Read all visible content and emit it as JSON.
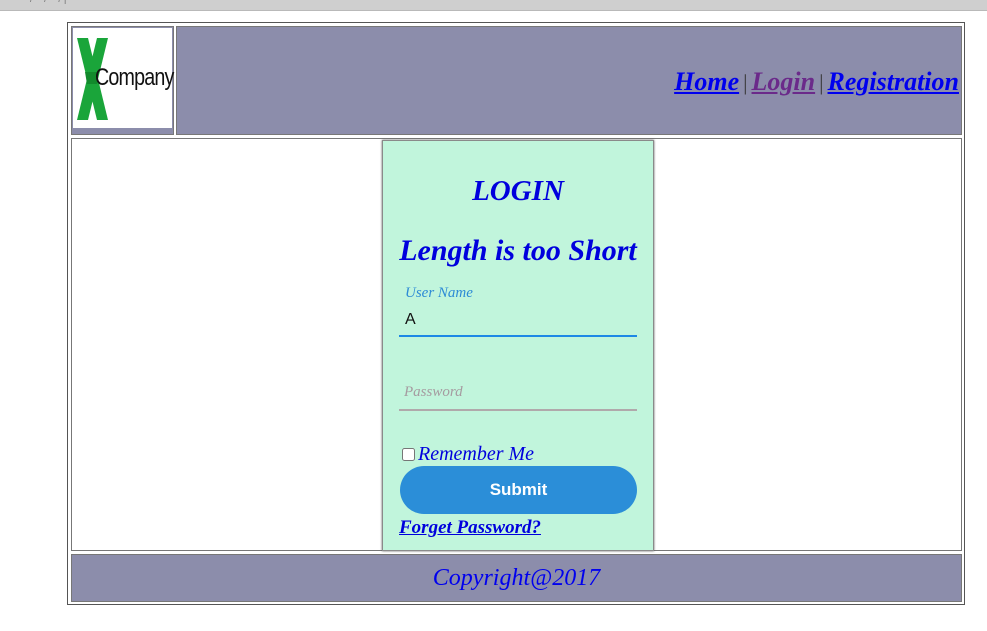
{
  "logo": {
    "text": "Company",
    "mark_color": "#1aa53a"
  },
  "nav": {
    "home": "Home",
    "login": "Login",
    "registration": "Registration",
    "separator": "|"
  },
  "login": {
    "title": "LOGIN",
    "error": "Length is too Short",
    "username_label": "User Name",
    "username_value": "A",
    "password_placeholder": "Password",
    "remember_label": "Remember Me",
    "submit_label": "Submit",
    "forgot_label": "Forget Password?"
  },
  "footer": {
    "copyright": "Copyright@2017"
  },
  "colors": {
    "header_bg": "#8c8dab",
    "login_bg": "#c1f5dc",
    "accent": "#2b8ed8",
    "link": "#0000ee"
  }
}
